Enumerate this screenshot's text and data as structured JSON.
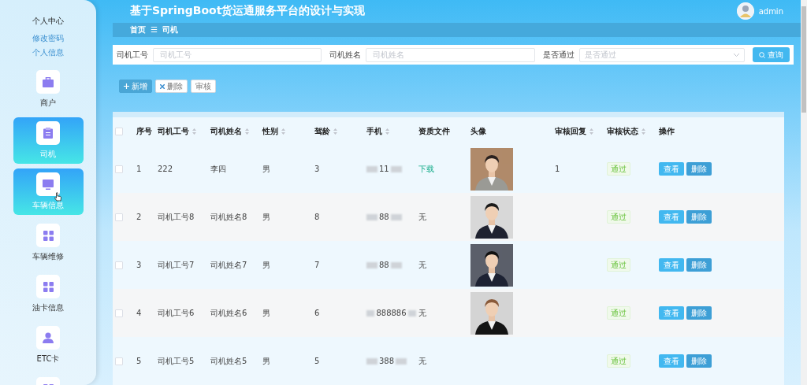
{
  "header": {
    "title": "基于SpringBoot货运通服务平台的设计与实现",
    "user": "admin"
  },
  "sidebar": {
    "section_title": "个人中心",
    "links": [
      "修改密码",
      "个人信息"
    ],
    "items": [
      {
        "label": "商户",
        "selected": false
      },
      {
        "label": "司机",
        "selected": true
      },
      {
        "label": "车辆信息",
        "selected": true,
        "hovered": true
      },
      {
        "label": "车辆维修",
        "selected": false
      },
      {
        "label": "油卡信息",
        "selected": false
      },
      {
        "label": "ETC卡",
        "selected": false
      },
      {
        "selected": false
      }
    ]
  },
  "breadcrumb": {
    "home": "首页",
    "separator": "☰",
    "current": "司机"
  },
  "search": {
    "fields": [
      {
        "label": "司机工号",
        "placeholder": "司机工号",
        "kind": "input"
      },
      {
        "label": "司机姓名",
        "placeholder": "司机姓名",
        "kind": "input"
      },
      {
        "label": "是否通过",
        "placeholder": "是否通过",
        "kind": "select"
      }
    ],
    "button": "查询"
  },
  "actions": [
    {
      "label": "新增",
      "kind": "primary"
    },
    {
      "label": "删除",
      "kind": "danger"
    },
    {
      "label": "审核",
      "kind": "plain"
    }
  ],
  "table": {
    "all_checked": false,
    "columns": [
      {
        "label": "序号",
        "sortable": false
      },
      {
        "label": "司机工号",
        "sortable": true
      },
      {
        "label": "司机姓名",
        "sortable": true
      },
      {
        "label": "性别",
        "sortable": true
      },
      {
        "label": "驾龄",
        "sortable": true
      },
      {
        "label": "手机",
        "sortable": true
      },
      {
        "label": "资质文件",
        "sortable": false
      },
      {
        "label": "头像",
        "sortable": false
      },
      {
        "label": "审核回复",
        "sortable": true
      },
      {
        "label": "审核状态",
        "sortable": true
      },
      {
        "label": "操作",
        "sortable": false
      }
    ],
    "rows": [
      {
        "checked": false,
        "index": "1",
        "id": "222",
        "name": "李四",
        "gender": "男",
        "years": "3",
        "phone": "11",
        "file": {
          "text": "下载",
          "kind": "link"
        },
        "photo": {
          "kind": "picture"
        },
        "reply": "1",
        "status": "通过",
        "actions": [
          "查看",
          "删除"
        ]
      },
      {
        "checked": false,
        "index": "2",
        "id": "司机工号8",
        "name": "司机姓名8",
        "gender": "男",
        "years": "8",
        "phone": "88",
        "file": {
          "text": "无",
          "kind": "text"
        },
        "photo": {
          "kind": "picture"
        },
        "status": "通过",
        "actions": [
          "查看",
          "删除"
        ]
      },
      {
        "checked": false,
        "index": "3",
        "id": "司机工号7",
        "name": "司机姓名7",
        "gender": "男",
        "years": "7",
        "phone": "88",
        "file": {
          "text": "无",
          "kind": "text"
        },
        "photo": {
          "kind": "picture"
        },
        "status": "通过",
        "actions": [
          "查看",
          "删除"
        ]
      },
      {
        "checked": false,
        "index": "4",
        "id": "司机工号6",
        "name": "司机姓名6",
        "gender": "男",
        "years": "6",
        "phone": "888886",
        "file": {
          "text": "无",
          "kind": "text"
        },
        "photo": {
          "kind": "picture"
        },
        "status": "通过",
        "actions": [
          "查看",
          "删除"
        ]
      },
      {
        "checked": false,
        "index": "5",
        "id": "司机工号5",
        "name": "司机姓名5",
        "gender": "男",
        "years": "5",
        "phone": "388",
        "file": {
          "text": "无",
          "kind": "text"
        },
        "status": "通过",
        "actions": [
          "查看",
          "删除"
        ]
      }
    ]
  }
}
